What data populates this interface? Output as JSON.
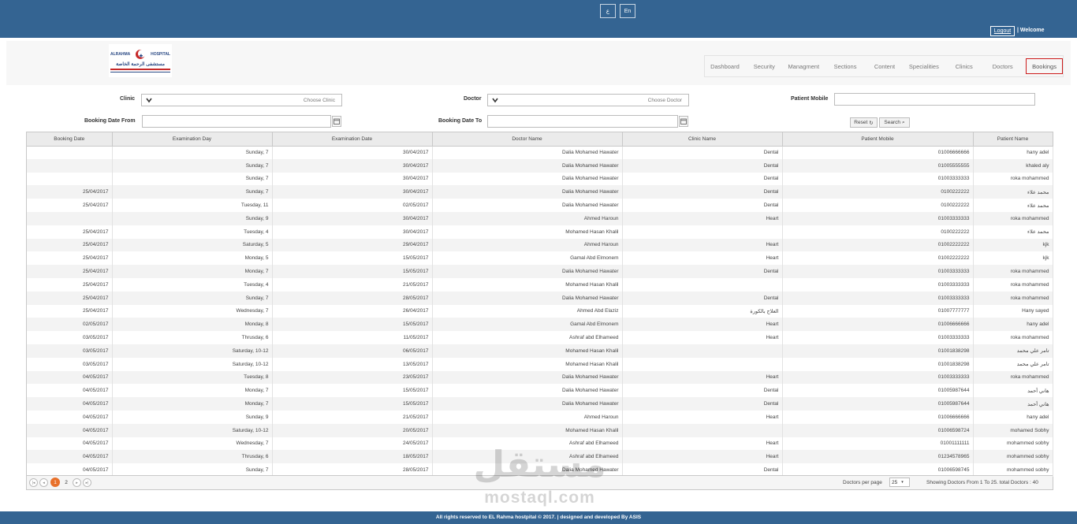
{
  "topbar": {
    "lang_ar": "ع",
    "lang_en": "En",
    "logout": "Logout",
    "welcome": "| Welcome"
  },
  "header": {
    "logo_text": "مستشفى الرحمة الخاصة",
    "logo_latin_left": "ALRAHMA",
    "logo_latin_right": "HOSPITAL"
  },
  "nav": {
    "items": [
      "Dashboard",
      "Security",
      "Managment",
      "Sections",
      "Content",
      "Specialities",
      "Clinics",
      "Doctors",
      "Bookings"
    ],
    "active": "Bookings"
  },
  "filters": {
    "clinic_label": "Clinic",
    "clinic_placeholder": "Choose Clinic",
    "doctor_label": "Doctor",
    "doctor_placeholder": "Choose Doctor",
    "mobile_label": "Patient Mobile",
    "date_from_label": "Booking Date From",
    "date_to_label": "Booking Date To",
    "reset": "Reset",
    "search": "Search"
  },
  "table": {
    "headers": [
      "Booking Date",
      "Examination Day",
      "Examination Date",
      "Doctor Name",
      "Clinic Name",
      "Patient Mobile",
      "Patient Name"
    ],
    "rows": [
      [
        "",
        "Sunday, 7",
        "30/04/2017",
        "Dalia Mohamed Hawater",
        "Dental",
        "01006666666",
        "hany adel"
      ],
      [
        "",
        "Sunday, 7",
        "30/04/2017",
        "Dalia Mohamed Hawater",
        "Dental",
        "01005555555",
        "khaled aly"
      ],
      [
        "",
        "Sunday, 7",
        "30/04/2017",
        "Dalia Mohamed Hawater",
        "Dental",
        "01003333333",
        "roka mohammed"
      ],
      [
        "25/04/2017",
        "Sunday, 7",
        "30/04/2017",
        "Dalia Mohamed Hawater",
        "Dental",
        "0100222222",
        "محمد علاء"
      ],
      [
        "25/04/2017",
        "Tuesday, 11",
        "02/05/2017",
        "Dalia Mohamed Hawater",
        "Dental",
        "0100222222",
        "محمد علاء"
      ],
      [
        "",
        "Sunday, 9",
        "30/04/2017",
        "Ahmed Haroun",
        "Heart",
        "01003333333",
        "roka mohammed"
      ],
      [
        "25/04/2017",
        "Tuesday, 4",
        "30/04/2017",
        "Mohamed Hasan Khalil",
        "",
        "0100222222",
        "محمد علاء"
      ],
      [
        "25/04/2017",
        "Saturday, 5",
        "29/04/2017",
        "Ahmed Haroun",
        "Heart",
        "01002222222",
        "kjk"
      ],
      [
        "25/04/2017",
        "Monday, 5",
        "15/05/2017",
        "Gamal Abd Elmonem",
        "Heart",
        "01002222222",
        "kjk"
      ],
      [
        "25/04/2017",
        "Monday, 7",
        "15/05/2017",
        "Dalia Mohamed Hawater",
        "Dental",
        "01003333333",
        "roka mohammed"
      ],
      [
        "25/04/2017",
        "Tuesday, 4",
        "21/05/2017",
        "Mohamed Hasan Khalil",
        "",
        "01003333333",
        "roka mohammed"
      ],
      [
        "25/04/2017",
        "Sunday, 7",
        "28/05/2017",
        "Dalia Mohamed Hawater",
        "Dental",
        "01003333333",
        "roka mohammed"
      ],
      [
        "25/04/2017",
        "Wednesday, 7",
        "26/04/2017",
        "Ahmed Abd Elaziz",
        "العلاج بالكورة",
        "01007777777",
        "Hany sayed"
      ],
      [
        "02/05/2017",
        "Monday, 8",
        "15/05/2017",
        "Gamal Abd Elmonem",
        "Heart",
        "01006666666",
        "hany adel"
      ],
      [
        "03/05/2017",
        "Thrusday, 6",
        "11/05/2017",
        "Ashraf abd Elhameed",
        "Heart",
        "01003333333",
        "roka mohammed"
      ],
      [
        "03/05/2017",
        "Saturday, 10-12",
        "06/05/2017",
        "Mohamed Hasan Khalil",
        "",
        "01001838298",
        "تامر علي محمد"
      ],
      [
        "03/05/2017",
        "Saturday, 10-12",
        "13/05/2017",
        "Mohamed Hasan Khalil",
        "",
        "01001838298",
        "تامر علي محمد"
      ],
      [
        "04/05/2017",
        "Tuesday, 8",
        "23/05/2017",
        "Dalia Mohamed Hawater",
        "Heart",
        "01003333333",
        "roka mohammed"
      ],
      [
        "04/05/2017",
        "Monday, 7",
        "15/05/2017",
        "Dalia Mohamed Hawater",
        "Dental",
        "01005987644",
        "هاني أحمد"
      ],
      [
        "04/05/2017",
        "Monday, 7",
        "15/05/2017",
        "Dalia Mohamed Hawater",
        "Dental",
        "01005987644",
        "هاني أحمد"
      ],
      [
        "04/05/2017",
        "Sunday, 9",
        "21/05/2017",
        "Ahmed Haroun",
        "Heart",
        "01006666666",
        "hany adel"
      ],
      [
        "04/05/2017",
        "Saturday, 10-12",
        "20/05/2017",
        "Mohamed Hasan Khalil",
        "",
        "01006598724",
        "mohamed Sobhy"
      ],
      [
        "04/05/2017",
        "Wednesday, 7",
        "24/05/2017",
        "Ashraf abd Elhameed",
        "Heart",
        "01001111111",
        "mohammed sobhy"
      ],
      [
        "04/05/2017",
        "Thrusday, 6",
        "18/05/2017",
        "Ashraf abd Elhameed",
        "Heart",
        "01234578965",
        "mohammed sobhy"
      ],
      [
        "04/05/2017",
        "Sunday, 7",
        "28/05/2017",
        "Dalia Mohamed Hawater",
        "Dental",
        "01006598745",
        "mohammed sobhy"
      ]
    ]
  },
  "pager": {
    "pages": [
      "1",
      "2"
    ],
    "current": "1",
    "per_page_label": "Doctors per page",
    "per_page_value": "25",
    "summary": "Showing Doctors From 1 To 25. total Doctors : 40"
  },
  "watermark": {
    "arabic": "مستقل",
    "latin": "mostaql.com"
  },
  "footer": {
    "text": "All rights reserved to EL Rahma hostpital © 2017. | designed and developed By ASIS"
  },
  "colors": {
    "brand_blue": "#346492",
    "active_nav_border": "#cc1b1b",
    "pager_current": "#e8702a"
  }
}
